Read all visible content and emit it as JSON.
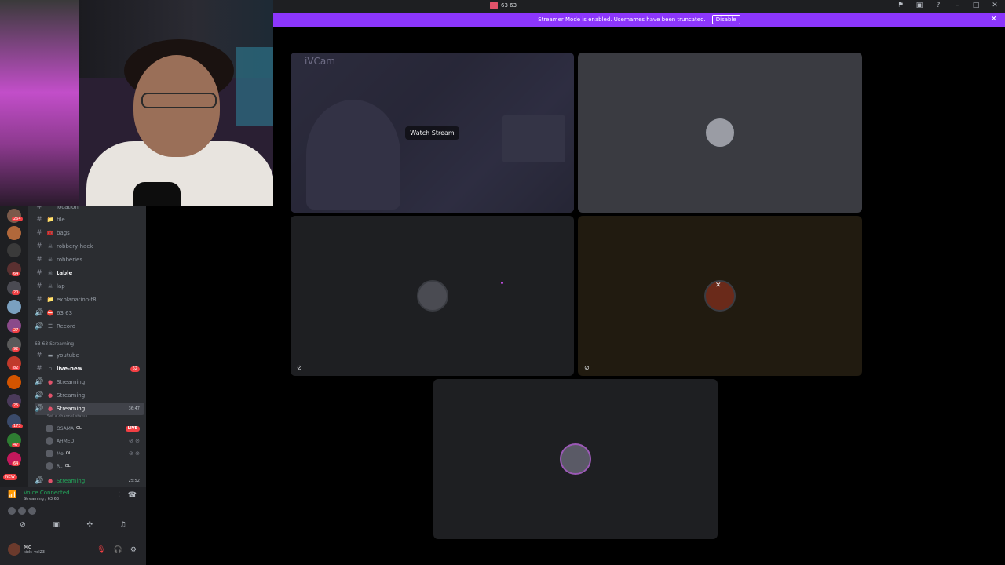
{
  "window": {
    "title": "63 63"
  },
  "banner": {
    "text": "Streamer Mode is enabled. Usernames have been truncated.",
    "button": "Disable"
  },
  "channels": [
    {
      "icon": "#",
      "emoji": "",
      "name": "location",
      "bold": false
    },
    {
      "icon": "#",
      "emoji": "📁",
      "name": "file",
      "bold": false
    },
    {
      "icon": "#",
      "emoji": "🧰",
      "name": "bags",
      "bold": false
    },
    {
      "icon": "#",
      "emoji": "☠",
      "name": "robbery-hack",
      "bold": false
    },
    {
      "icon": "#",
      "emoji": "☠",
      "name": "robberies",
      "bold": false
    },
    {
      "icon": "#",
      "emoji": "☠",
      "name": "table",
      "bold": true
    },
    {
      "icon": "#",
      "emoji": "☠",
      "name": "lap",
      "bold": false
    },
    {
      "icon": "#",
      "emoji": "📁",
      "name": "explanation-f8",
      "bold": false
    },
    {
      "icon": "🔊",
      "emoji": "⛔",
      "name": "63 63",
      "bold": false
    },
    {
      "icon": "🔊",
      "emoji": "☰",
      "name": "Record",
      "bold": false
    }
  ],
  "category": "63 63 Streaming",
  "streaming_channels": [
    {
      "icon": "#",
      "emoji": "▬",
      "name": "youtube",
      "bold": false
    },
    {
      "icon": "#",
      "emoji": "▫",
      "name": "live-new",
      "bold": true,
      "count": "62"
    },
    {
      "icon": "🔊",
      "emoji": "●",
      "name": "Streaming"
    },
    {
      "icon": "🔊",
      "emoji": "●",
      "name": "Streaming"
    }
  ],
  "active_channel": {
    "name": "Streaming",
    "time": "36:47",
    "status": "Set a channel status"
  },
  "users": [
    {
      "name": "OSAMA",
      "tag": "OL",
      "live": "LIVE"
    },
    {
      "name": "AHMED",
      "tag": ""
    },
    {
      "name": "Mo",
      "tag": "OL"
    },
    {
      "name": "R..",
      "tag": "OL"
    }
  ],
  "last_channel": {
    "name": "Streaming",
    "time": "25:52"
  },
  "voice": {
    "status": "Voice Connected",
    "location": "Streaming / 63 63"
  },
  "me": {
    "name": "Mo",
    "status": "kick: vol23"
  },
  "server_badges": [
    "264",
    "64",
    "20",
    "27",
    "92",
    "82",
    "25",
    "173",
    "47",
    "64"
  ],
  "server_new": "NEW",
  "stage": {
    "watch_label": "Watch Stream",
    "ivcam_label": "iVCam"
  },
  "colors": {
    "accent": "#8c36fc",
    "online": "#23a55a",
    "danger": "#f23f43"
  }
}
